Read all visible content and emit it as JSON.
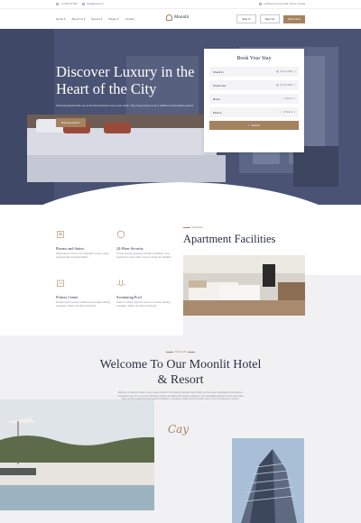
{
  "topbar": {
    "phone": "+1 (234) 567 890",
    "email": "hotel@gmail.com",
    "address": "123 Bayview Avenue #99, Toronto, Canada"
  },
  "nav": {
    "items": [
      "Home",
      "About Us",
      "Rooms",
      "Pages",
      "Contact"
    ],
    "logo": "Moonlit",
    "sign_in": "Sign In",
    "sign_up": "Sign Up",
    "book_now": "Book Now"
  },
  "hero": {
    "title": "Discover Luxury in the Heart of the City",
    "description": "Choosing Moonlit was one of the best decisions we've ever made. They have proven to be a reliable and innovative partner.",
    "button": "Discover Room"
  },
  "booking": {
    "title": "Book Your Stay",
    "rows": [
      {
        "label": "Check In",
        "value": "11 Oct 2024",
        "icon": "calendar-icon"
      },
      {
        "label": "Check Out",
        "value": "12 Oct 2024",
        "icon": "calendar-icon"
      },
      {
        "label": "Room",
        "value": "1 Room",
        "icon": "bed-icon"
      },
      {
        "label": "Person",
        "value": "2 Person",
        "icon": "user-icon"
      }
    ],
    "search": "Search"
  },
  "facilities": {
    "label": "Facilities",
    "heading": "Apartment Facilities",
    "items": [
      {
        "title": "Rooms and Suites",
        "desc": "Varied types of rooms, from standard to luxury suites, equipped with essential facilities."
      },
      {
        "title": "24-Hour Security",
        "desc": "On-site security personnel and 24h surveillance. Free extended in-luxury suites. Secure storage for valuables."
      },
      {
        "title": "Fitness Center",
        "desc": "Equipped with exercise machines and weights offering massages, facials, and other treatments."
      },
      {
        "title": "Swimming Pool",
        "desc": "Indoor or outdoor pools for leisure or exercise offering massages, facials, and other treatments."
      }
    ]
  },
  "about": {
    "label": "About US",
    "title": "Welcome To Our Moonlit Hotel & Resort",
    "text": "Welcome to Moonlit, where luxury meets comfort in the heart of canada. Since 1999, we have been dedicated to providing an exceptional stay for our guests. Blending modern amenities with timeless elegance. Our beautifully designed rooms and suites offer stunning views and plush accommodations, ensuring a restful retreat whether you're here for business or leisure.",
    "signature": "Cay"
  },
  "colors": {
    "accent": "#a58260",
    "ink": "#2b2f45",
    "hero": "#4c5675"
  }
}
